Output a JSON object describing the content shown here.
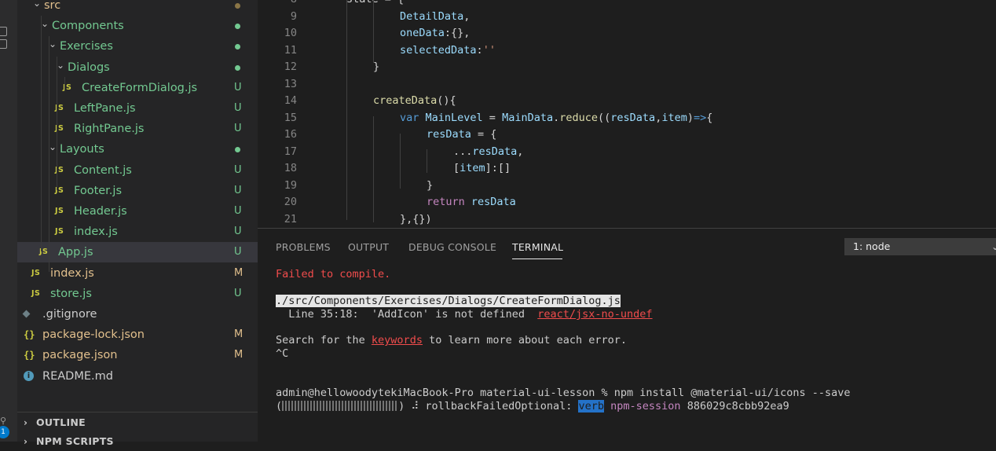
{
  "explorer": {
    "items": [
      {
        "label": "src",
        "kind": "folder",
        "status": "dot",
        "status_color": "#8a7546",
        "color": "#e2c08d"
      },
      {
        "label": "Components",
        "kind": "folder",
        "status": "dot",
        "status_color": "#73c991",
        "color": "#73c991"
      },
      {
        "label": "Exercises",
        "kind": "folder",
        "status": "dot",
        "status_color": "#73c991",
        "color": "#73c991"
      },
      {
        "label": "Dialogs",
        "kind": "folder",
        "status": "dot",
        "status_color": "#73c991",
        "color": "#73c991"
      },
      {
        "label": "CreateFormDialog.js",
        "kind": "file",
        "icon": "JS",
        "status": "U",
        "color": "#73c991"
      },
      {
        "label": "LeftPane.js",
        "kind": "file",
        "icon": "JS",
        "status": "U",
        "color": "#73c991"
      },
      {
        "label": "RightPane.js",
        "kind": "file",
        "icon": "JS",
        "status": "U",
        "color": "#73c991"
      },
      {
        "label": "Layouts",
        "kind": "folder",
        "status": "dot",
        "status_color": "#73c991",
        "color": "#73c991"
      },
      {
        "label": "Content.js",
        "kind": "file",
        "icon": "JS",
        "status": "U",
        "color": "#73c991"
      },
      {
        "label": "Footer.js",
        "kind": "file",
        "icon": "JS",
        "status": "U",
        "color": "#73c991"
      },
      {
        "label": "Header.js",
        "kind": "file",
        "icon": "JS",
        "status": "U",
        "color": "#73c991"
      },
      {
        "label": "index.js",
        "kind": "file",
        "icon": "JS",
        "status": "U",
        "color": "#73c991"
      },
      {
        "label": "App.js",
        "kind": "file",
        "icon": "JS",
        "status": "U",
        "color": "#73c991",
        "selected": true
      },
      {
        "label": "index.js",
        "kind": "file",
        "icon": "JS",
        "status": "M",
        "color": "#e2c08d"
      },
      {
        "label": "store.js",
        "kind": "file",
        "icon": "JS",
        "status": "U",
        "color": "#73c991"
      },
      {
        "label": ".gitignore",
        "kind": "file",
        "icon": "git",
        "status": "",
        "color": "#cccccc"
      },
      {
        "label": "package-lock.json",
        "kind": "file",
        "icon": "{}",
        "status": "M",
        "color": "#e2c08d"
      },
      {
        "label": "package.json",
        "kind": "file",
        "icon": "{}",
        "status": "M",
        "color": "#e2c08d"
      },
      {
        "label": "README.md",
        "kind": "file",
        "icon": "info",
        "status": "",
        "color": "#cccccc"
      }
    ],
    "outline_label": "OUTLINE",
    "npm_scripts_label": "NPM SCRIPTS"
  },
  "activity_badge": "1",
  "editor": {
    "lines": [
      {
        "n": "8",
        "indent": 0,
        "tokens": [
          [
            "state = {",
            "t-p"
          ]
        ]
      },
      {
        "n": "9",
        "indent": 2,
        "tokens": [
          [
            "DetailData",
            "t-var"
          ],
          [
            ",",
            "t-p"
          ]
        ]
      },
      {
        "n": "10",
        "indent": 2,
        "tokens": [
          [
            "oneData",
            "t-var"
          ],
          [
            ":{},",
            "t-p"
          ]
        ]
      },
      {
        "n": "11",
        "indent": 2,
        "tokens": [
          [
            "selectedData",
            "t-var"
          ],
          [
            ":",
            "t-p"
          ],
          [
            "''",
            "t-str"
          ]
        ]
      },
      {
        "n": "12",
        "indent": 1,
        "tokens": [
          [
            "}",
            "t-p"
          ]
        ]
      },
      {
        "n": "13",
        "indent": 0,
        "tokens": []
      },
      {
        "n": "14",
        "indent": 1,
        "tokens": [
          [
            "createData",
            "t-fn"
          ],
          [
            "(){",
            "t-p"
          ]
        ]
      },
      {
        "n": "15",
        "indent": 2,
        "tokens": [
          [
            "var ",
            "t-sk"
          ],
          [
            "MainLevel",
            "t-var"
          ],
          [
            " = ",
            "t-p"
          ],
          [
            "MainData",
            "t-var"
          ],
          [
            ".",
            "t-p"
          ],
          [
            "reduce",
            "t-fn"
          ],
          [
            "((",
            "t-p"
          ],
          [
            "resData",
            "t-var"
          ],
          [
            ",",
            "t-p"
          ],
          [
            "item",
            "t-var"
          ],
          [
            ")",
            "t-p"
          ],
          [
            "=>",
            "t-sk"
          ],
          [
            "{",
            "t-p"
          ]
        ]
      },
      {
        "n": "16",
        "indent": 3,
        "tokens": [
          [
            "resData",
            "t-var"
          ],
          [
            " = {",
            "t-p"
          ]
        ]
      },
      {
        "n": "17",
        "indent": 4,
        "tokens": [
          [
            "...",
            "t-p"
          ],
          [
            "resData",
            "t-var"
          ],
          [
            ",",
            "t-p"
          ]
        ]
      },
      {
        "n": "18",
        "indent": 4,
        "tokens": [
          [
            "[",
            "t-p"
          ],
          [
            "item",
            "t-var"
          ],
          [
            "]:[]",
            "t-p"
          ]
        ]
      },
      {
        "n": "19",
        "indent": 3,
        "tokens": [
          [
            "}",
            "t-p"
          ]
        ]
      },
      {
        "n": "20",
        "indent": 3,
        "tokens": [
          [
            "return ",
            "t-kw"
          ],
          [
            "resData",
            "t-var"
          ]
        ]
      },
      {
        "n": "21",
        "indent": 2,
        "tokens": [
          [
            "},{})",
            "t-p"
          ]
        ]
      }
    ]
  },
  "panel": {
    "tabs": [
      "PROBLEMS",
      "OUTPUT",
      "DEBUG CONSOLE",
      "TERMINAL"
    ],
    "active_tab": "TERMINAL",
    "terminal_select": "1: node"
  },
  "terminal": {
    "failed": "Failed to compile.",
    "path": "./src/Components/Exercises/Dialogs/CreateFormDialog.js",
    "line_info": "  Line 35:18:  'AddIcon' is not defined  ",
    "rule": "react/jsx-no-undef",
    "search_pre": "Search for the ",
    "search_link": "keywords",
    "search_post": " to learn more about each error.",
    "ctrl_c": "^C",
    "prompt": "admin@hellowoodytekiMacBook-Pro material-ui-lesson % npm install @material-ui/icons --save",
    "progress_open": "(",
    "progress_close": ") ⠼ rollbackFailedOptional: ",
    "verb": "verb",
    "npm_session": "npm-session",
    "session_id": "886029c8cbb92ea9"
  }
}
